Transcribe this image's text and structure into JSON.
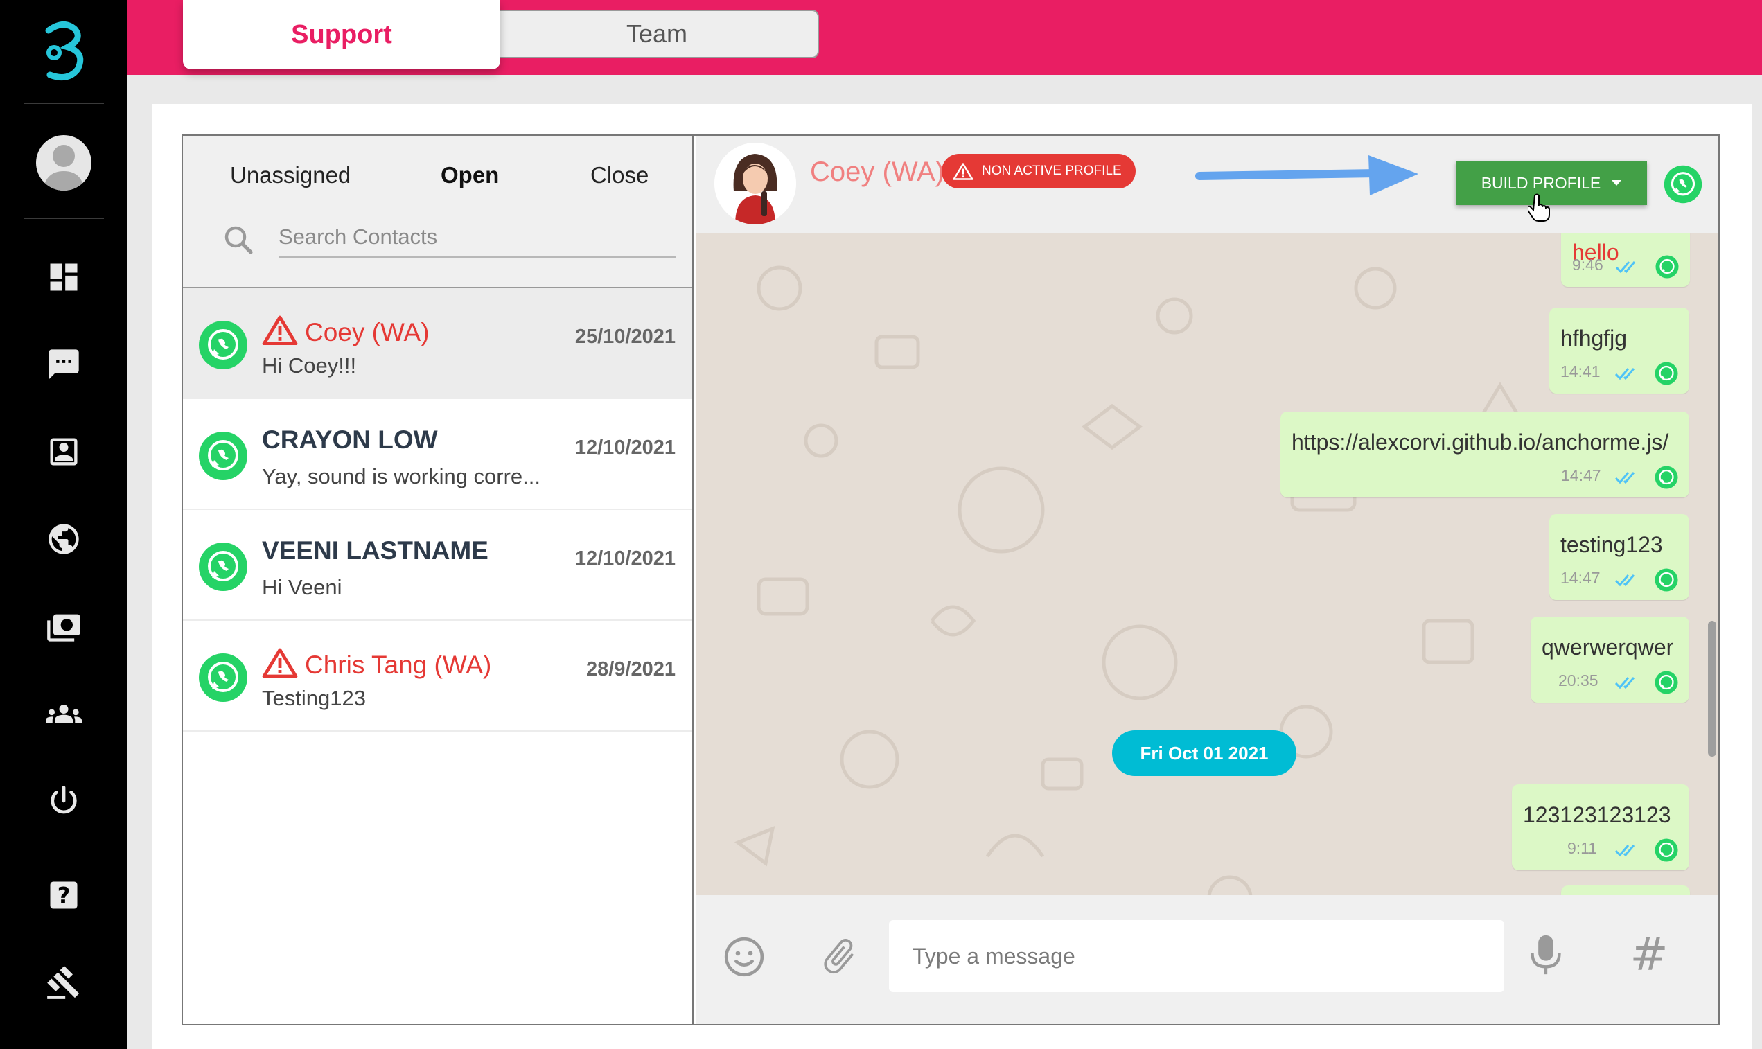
{
  "header": {
    "tabs": [
      {
        "label": "Support",
        "active": true
      },
      {
        "label": "Team",
        "active": false
      }
    ]
  },
  "sidebar": {
    "items": [
      {
        "icon": "dashboard-icon"
      },
      {
        "icon": "chat-icon"
      },
      {
        "icon": "contacts-icon"
      },
      {
        "icon": "globe-icon"
      },
      {
        "icon": "broadcast-icon"
      },
      {
        "icon": "team-icon"
      },
      {
        "icon": "power-icon"
      },
      {
        "icon": "help-icon"
      },
      {
        "icon": "gavel-icon"
      }
    ]
  },
  "contacts_panel": {
    "filters": [
      "Unassigned",
      "Open",
      "Close"
    ],
    "active_filter": "Open",
    "search": {
      "placeholder": "Search Contacts",
      "value": ""
    },
    "contacts": [
      {
        "name": "Coey (WA)",
        "preview": "Hi Coey!!!",
        "date": "25/10/2021",
        "warning": true,
        "selected": true
      },
      {
        "name": "CRAYON LOW",
        "preview": "Yay, sound is working corre...",
        "date": "12/10/2021",
        "warning": false,
        "selected": false
      },
      {
        "name": "VEENI LASTNAME",
        "preview": "Hi Veeni",
        "date": "12/10/2021",
        "warning": false,
        "selected": false
      },
      {
        "name": "Chris Tang (WA)",
        "preview": "Testing123",
        "date": "28/9/2021",
        "warning": true,
        "selected": false
      }
    ]
  },
  "chat": {
    "contact_name": "Coey (WA)",
    "status_badge": "NON ACTIVE PROFILE",
    "build_profile_label": "BUILD PROFILE",
    "messages": [
      {
        "text": "hello",
        "time": "9:46"
      },
      {
        "text": "hfhgfjg",
        "time": "14:41"
      },
      {
        "text": "https://alexcorvi.github.io/anchorme.js/",
        "time": "14:47"
      },
      {
        "text": "testing123",
        "time": "14:47"
      },
      {
        "text": "qwerwerqwer",
        "time": "20:35"
      },
      {
        "text": "123123123123",
        "time": "9:11"
      }
    ],
    "date_divider": "Fri Oct 01 2021",
    "composer": {
      "placeholder": "Type a message",
      "value": ""
    }
  },
  "colors": {
    "brand": "#e91e63",
    "whatsapp": "#25d366",
    "build_button": "#43a047",
    "date_pill": "#00bcd4",
    "warning": "#e53935",
    "bubble": "#dcf8c6"
  }
}
